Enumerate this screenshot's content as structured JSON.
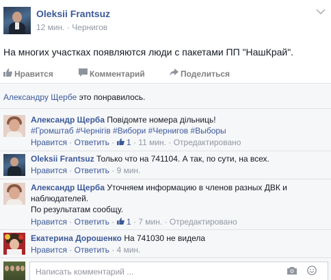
{
  "post": {
    "author": "Oleksii Frantsuz",
    "time": "12 мин.",
    "separator": "·",
    "location": "Чернигов",
    "text": "На многих участках появляются люди с пакетами ПП \"НашКрай\"."
  },
  "actions": {
    "like": "Нравится",
    "comment": "Комментарий",
    "share": "Поделиться"
  },
  "likes": {
    "name": "Александру Щербе",
    "text": " это понравилось."
  },
  "comments": [
    {
      "author": "Александр Щерба",
      "text": "Повідомте номера дільниць!",
      "tags": "#Громштаб #Чернігів #Вибори #Чернигов #Выборы",
      "like": "Нравится",
      "reply": "Ответить",
      "like_count": "1",
      "time": "11 мин.",
      "edited": "Отредактировано"
    },
    {
      "author": "Oleksii Frantsuz",
      "text": "Только что на 741104. А так, по сути, на всех.",
      "like": "Нравится",
      "reply": "Ответить",
      "time": "9 мин."
    },
    {
      "author": "Александр Щерба",
      "text": "Уточняем информацию в членов разных ДВК и",
      "text2": "наблюдателей.",
      "text3": "По результатам сообщу.",
      "like": "Нравится",
      "reply": "Ответить",
      "like_count": "1",
      "time": "7 мин.",
      "edited": "Отредактировано"
    },
    {
      "author": "Екатерина Дорошенко",
      "text": "На 741030 не видела",
      "like": "Нравится",
      "reply": "Ответить",
      "time": "4 мин."
    }
  ],
  "write": {
    "placeholder": "Написать комментарий ..."
  },
  "icons": {
    "chevron": "chevron-down-icon",
    "like": "thumbs-up-icon",
    "comment": "speech-bubble-icon",
    "share": "share-arrow-icon",
    "camera": "camera-icon",
    "emoji": "smiley-icon"
  }
}
